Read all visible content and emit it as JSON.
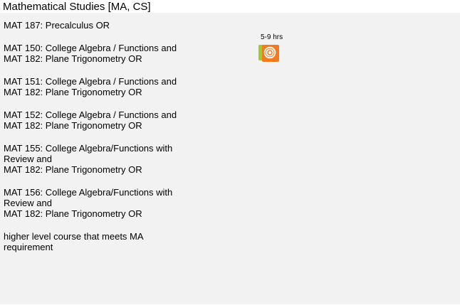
{
  "header": {
    "title": "Mathematical Studies [MA, CS]"
  },
  "requirements": {
    "blocks": [
      {
        "lines": [
          "MAT 187: Precalculus OR"
        ]
      },
      {
        "lines": [
          "MAT 150: College Algebra / Functions and",
          "MAT 182: Plane Trigonometry OR"
        ]
      },
      {
        "lines": [
          "MAT 151: College Algebra / Functions and",
          "MAT 182: Plane Trigonometry OR"
        ]
      },
      {
        "lines": [
          "MAT 152: College Algebra / Functions and",
          "MAT 182: Plane Trigonometry OR"
        ]
      },
      {
        "lines": [
          "MAT 155: College Algebra/Functions with",
          "Review and",
          "MAT 182: Plane Trigonometry OR"
        ]
      },
      {
        "lines": [
          "MAT 156: College Algebra/Functions with",
          "Review and",
          "MAT 182: Plane Trigonometry OR"
        ]
      },
      {
        "lines": [
          "higher level course that meets MA",
          "requirement"
        ]
      }
    ]
  },
  "credit": {
    "hours": "5-9 hrs"
  },
  "icons": [
    {
      "name": "a-star-icon",
      "color": "#9acd32"
    },
    {
      "name": "target-circle-icon",
      "color": "#f47a20"
    }
  ]
}
